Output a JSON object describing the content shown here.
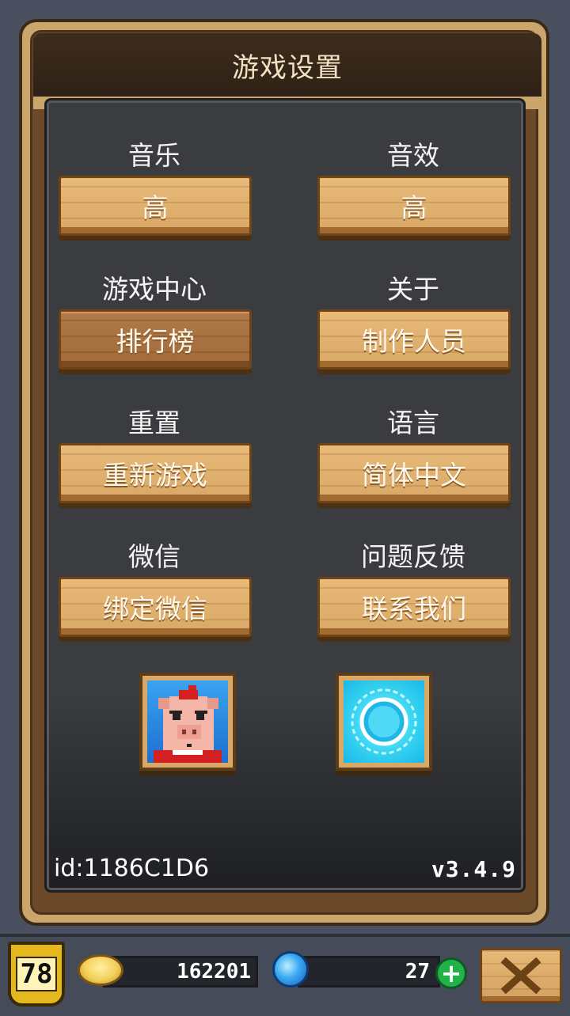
{
  "dialog": {
    "title": "游戏设置"
  },
  "settings": [
    {
      "label": "音乐",
      "button": "高"
    },
    {
      "label": "音效",
      "button": "高"
    },
    {
      "label": "游戏中心",
      "button": "排行榜"
    },
    {
      "label": "关于",
      "button": "制作人员"
    },
    {
      "label": "重置",
      "button": "重新游戏"
    },
    {
      "label": "语言",
      "button": "简体中文"
    },
    {
      "label": "微信",
      "button": "绑定微信"
    },
    {
      "label": "问题反馈",
      "button": "联系我们"
    }
  ],
  "footer": {
    "id": "id:1186C1D6",
    "version": "v3.4.9"
  },
  "bottom_bar": {
    "level": "78",
    "coins": "162201",
    "gems": "27"
  },
  "colors": {
    "wood": "#d9a866",
    "frame": "#caa66c",
    "panel": "#3a3c40",
    "plus": "#22b24a"
  }
}
